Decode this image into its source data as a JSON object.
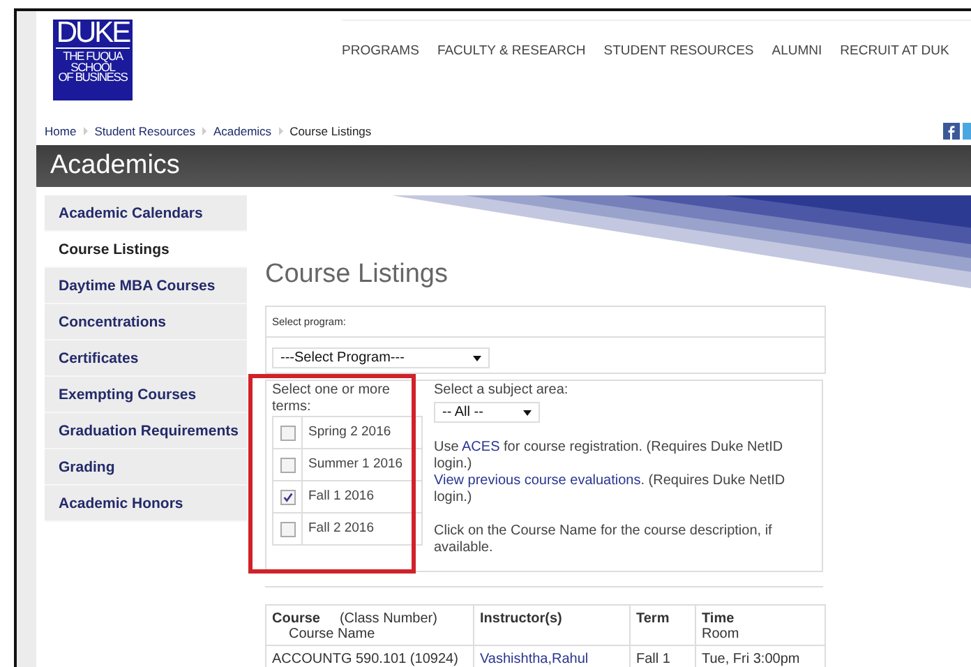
{
  "logo": {
    "lines": [
      "DUKE",
      "THE FUQUA",
      "SCHOOL",
      "OF BUSINESS"
    ]
  },
  "nav": [
    "PROGRAMS",
    "FACULTY & RESEARCH",
    "STUDENT RESOURCES",
    "ALUMNI",
    "RECRUIT AT DUK"
  ],
  "breadcrumb": [
    "Home",
    "Student Resources",
    "Academics",
    "Course Listings"
  ],
  "section_title": "Academics",
  "sidebar": {
    "items": [
      {
        "label": "Academic Calendars",
        "selected": false
      },
      {
        "label": "Course Listings",
        "selected": true
      },
      {
        "label": "Daytime MBA Courses",
        "selected": false
      },
      {
        "label": "Concentrations",
        "selected": false
      },
      {
        "label": "Certificates",
        "selected": false
      },
      {
        "label": "Exempting Courses",
        "selected": false
      },
      {
        "label": "Graduation Requirements",
        "selected": false
      },
      {
        "label": "Grading",
        "selected": false
      },
      {
        "label": "Academic Honors",
        "selected": false
      }
    ]
  },
  "page_title": "Course Listings",
  "program": {
    "label": "Select program:",
    "value": "---Select Program---"
  },
  "terms": {
    "label": "Select one or more terms:",
    "items": [
      {
        "label": "Spring 2 2016",
        "checked": false
      },
      {
        "label": "Summer 1 2016",
        "checked": false
      },
      {
        "label": "Fall 1 2016",
        "checked": true
      },
      {
        "label": "Fall 2 2016",
        "checked": false
      }
    ]
  },
  "subject": {
    "label": "Select a subject area:",
    "value": "-- All --"
  },
  "notes": [
    {
      "before": "Use ",
      "link": "ACES",
      "after": " for course registration. (Requires Duke NetID login.)"
    },
    {
      "link": "View previous course evaluations",
      "after": ". (Requires Duke NetID login.)"
    },
    {
      "before": "Click on the Course Name for the course description, if available."
    }
  ],
  "table": {
    "columns": [
      {
        "title": "Course",
        "note": "(Class Number)",
        "sub": "Course Name"
      },
      {
        "title": "Instructor(s)"
      },
      {
        "title": "Term"
      },
      {
        "title": "Time",
        "sub": "Room"
      }
    ],
    "rows": [
      {
        "course": "ACCOUNTG 590.101 (10924)",
        "instructor": "Vashishtha,Rahul",
        "term": "Fall 1",
        "time": "Tue, Fri 3:00pm"
      }
    ]
  }
}
